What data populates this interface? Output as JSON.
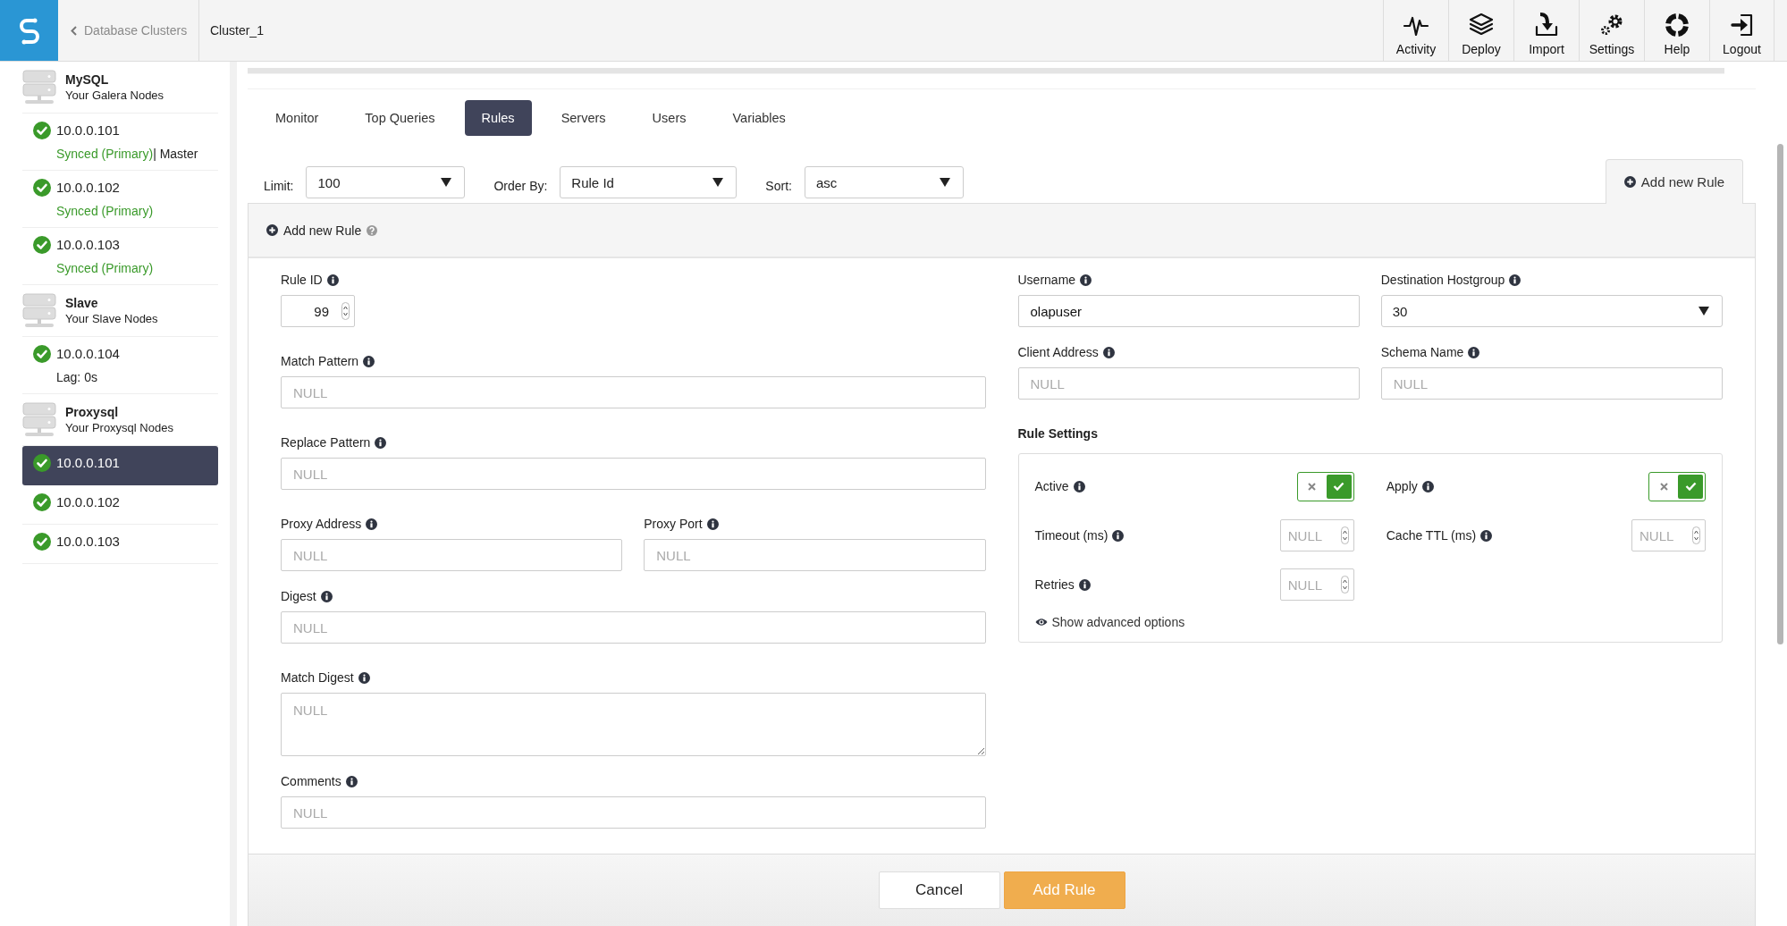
{
  "header": {
    "back_link": "Database Clusters",
    "cluster": "Cluster_1",
    "nav": [
      {
        "label": "Activity",
        "kind": "activity"
      },
      {
        "label": "Deploy",
        "kind": "deploy"
      },
      {
        "label": "Import",
        "kind": "import"
      },
      {
        "label": "Settings",
        "kind": "settings"
      },
      {
        "label": "Help",
        "kind": "help"
      },
      {
        "label": "Logout",
        "kind": "logout"
      }
    ]
  },
  "sidebar": {
    "groups": [
      {
        "title": "MySQL",
        "subtitle": "Your Galera Nodes",
        "nodes": [
          {
            "address": "10.0.0.101",
            "status": "Synced (Primary)",
            "detail": "| Master",
            "selected": false
          },
          {
            "address": "10.0.0.102",
            "status": "Synced (Primary)",
            "selected": false
          },
          {
            "address": "10.0.0.103",
            "status": "Synced (Primary)",
            "selected": false
          }
        ]
      },
      {
        "title": "Slave",
        "subtitle": "Your Slave Nodes",
        "nodes": [
          {
            "address": "10.0.0.104",
            "detail": "Lag: 0s",
            "selected": false
          }
        ]
      },
      {
        "title": "Proxysql",
        "subtitle": "Your Proxysql Nodes",
        "nodes": [
          {
            "address": "10.0.0.101",
            "selected": true
          },
          {
            "address": "10.0.0.102",
            "selected": false
          },
          {
            "address": "10.0.0.103",
            "selected": false
          }
        ]
      }
    ]
  },
  "tabs": [
    {
      "label": "Monitor",
      "selected": false
    },
    {
      "label": "Top Queries",
      "selected": false
    },
    {
      "label": "Rules",
      "selected": true
    },
    {
      "label": "Servers",
      "selected": false
    },
    {
      "label": "Users",
      "selected": false
    },
    {
      "label": "Variables",
      "selected": false
    }
  ],
  "filters": [
    {
      "label": "Limit:",
      "value": "100"
    },
    {
      "label": "Order By:",
      "value": "Rule Id"
    },
    {
      "label": "Sort:",
      "value": "asc"
    }
  ],
  "add_rule_tab": "Add new Rule",
  "panel": {
    "title": "Add new Rule",
    "left_fields": [
      {
        "kind": "number",
        "label": "Rule ID",
        "value": "99"
      },
      {
        "kind": "text",
        "label": "Match Pattern",
        "placeholder": "NULL"
      },
      {
        "kind": "text",
        "label": "Replace Pattern",
        "placeholder": "NULL"
      },
      {
        "kind": "pair",
        "fields": [
          {
            "label": "Proxy Address",
            "placeholder": "NULL"
          },
          {
            "label": "Proxy Port",
            "placeholder": "NULL"
          }
        ]
      },
      {
        "kind": "text",
        "label": "Digest",
        "placeholder": "NULL"
      },
      {
        "kind": "textarea",
        "label": "Match Digest",
        "placeholder": "NULL"
      },
      {
        "kind": "text",
        "label": "Comments",
        "placeholder": "NULL"
      }
    ],
    "right_fields": [
      {
        "kind": "text",
        "label": "Username",
        "value": "olapuser"
      },
      {
        "kind": "select",
        "label": "Destination Hostgroup",
        "value": "30"
      },
      {
        "kind": "text",
        "label": "Client Address",
        "placeholder": "NULL"
      },
      {
        "kind": "text",
        "label": "Schema Name",
        "placeholder": "NULL"
      }
    ],
    "rule_settings": {
      "title": "Rule Settings",
      "items": [
        {
          "kind": "toggle",
          "label": "Active",
          "on": true
        },
        {
          "kind": "toggle",
          "label": "Apply",
          "on": true
        },
        {
          "kind": "number",
          "label": "Timeout (ms)",
          "placeholder": "NULL"
        },
        {
          "kind": "number",
          "label": "Cache TTL (ms)",
          "placeholder": "NULL"
        },
        {
          "kind": "number",
          "label": "Retries",
          "placeholder": "NULL"
        }
      ],
      "advanced_link": "Show advanced options"
    },
    "buttons": [
      {
        "kind": "secondary",
        "label": "Cancel"
      },
      {
        "kind": "primary",
        "label": "Add Rule"
      }
    ]
  }
}
